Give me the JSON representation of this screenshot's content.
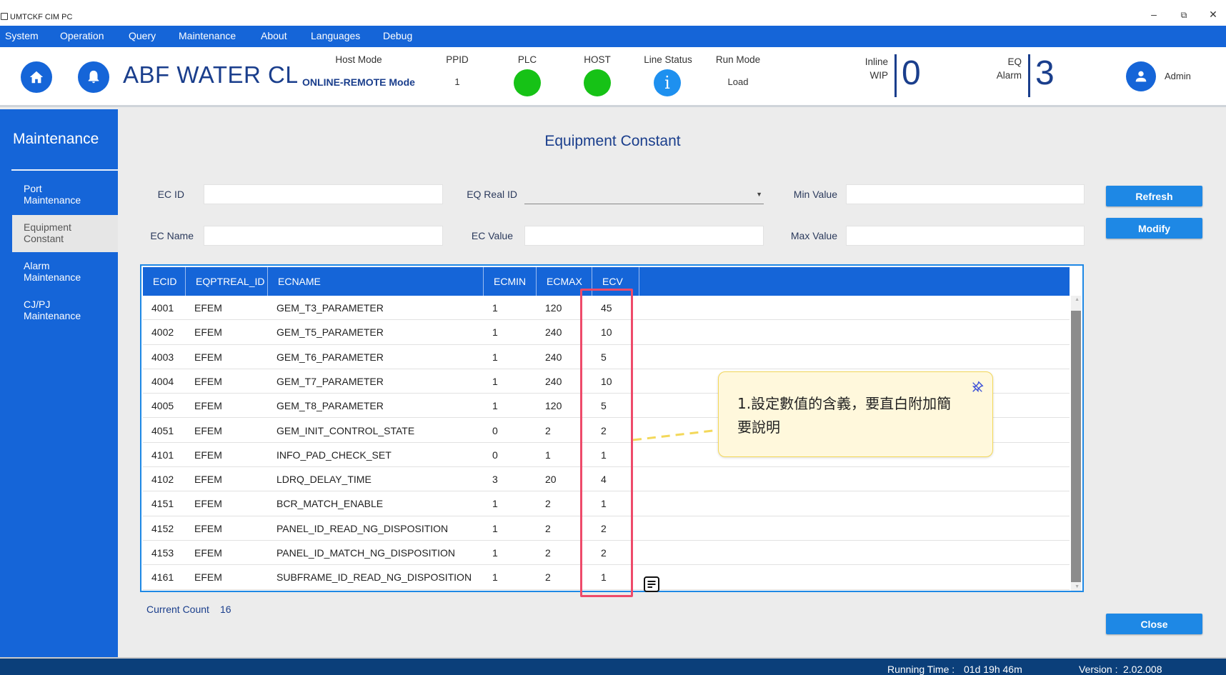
{
  "window": {
    "title": "UMTCKF CIM PC"
  },
  "menu": [
    "System",
    "Operation",
    "Query",
    "Maintenance",
    "About",
    "Languages",
    "Debug"
  ],
  "header": {
    "equipment_name": "ABF WATER CLEA",
    "host_mode": {
      "label": "Host Mode",
      "value": "ONLINE-REMOTE Mode"
    },
    "ppid": {
      "label": "PPID",
      "value": "1"
    },
    "plc": {
      "label": "PLC",
      "status_color": "#16c216"
    },
    "host": {
      "label": "HOST",
      "status_color": "#16c216"
    },
    "line_status": {
      "label": "Line Status",
      "icon": "info-icon"
    },
    "run_mode": {
      "label": "Run Mode",
      "value": "Load"
    },
    "inline_wip": {
      "label_1": "Inline",
      "label_2": "WIP",
      "value": "0"
    },
    "eq_alarm": {
      "label_1": "EQ",
      "label_2": "Alarm",
      "value": "3"
    },
    "user": "Admin"
  },
  "sidebar": {
    "title": "Maintenance",
    "items": [
      {
        "line1": "Port",
        "line2": "Maintenance",
        "active": false
      },
      {
        "line1": "Equipment",
        "line2": "Constant",
        "active": true
      },
      {
        "line1": "Alarm",
        "line2": "Maintenance",
        "active": false
      },
      {
        "line1": "CJ/PJ",
        "line2": "Maintenance",
        "active": false
      }
    ]
  },
  "main": {
    "title": "Equipment Constant",
    "form": {
      "ec_id_label": "EC ID",
      "ec_id_value": "",
      "eq_real_id_label": "EQ Real ID",
      "eq_real_id_value": "",
      "min_value_label": "Min Value",
      "min_value_value": "",
      "ec_name_label": "EC Name",
      "ec_name_value": "",
      "ec_value_label": "EC Value",
      "ec_value_value": "",
      "max_value_label": "Max Value",
      "max_value_value": ""
    },
    "buttons": {
      "refresh": "Refresh",
      "modify": "Modify",
      "close": "Close"
    },
    "table": {
      "columns": [
        "ECID",
        "EQPTREAL_ID",
        "ECNAME",
        "ECMIN",
        "ECMAX",
        "ECV"
      ],
      "rows": [
        [
          "4001",
          "EFEM",
          "GEM_T3_PARAMETER",
          "1",
          "120",
          "45"
        ],
        [
          "4002",
          "EFEM",
          "GEM_T5_PARAMETER",
          "1",
          "240",
          "10"
        ],
        [
          "4003",
          "EFEM",
          "GEM_T6_PARAMETER",
          "1",
          "240",
          "5"
        ],
        [
          "4004",
          "EFEM",
          "GEM_T7_PARAMETER",
          "1",
          "240",
          "10"
        ],
        [
          "4005",
          "EFEM",
          "GEM_T8_PARAMETER",
          "1",
          "120",
          "5"
        ],
        [
          "4051",
          "EFEM",
          "GEM_INIT_CONTROL_STATE",
          "0",
          "2",
          "2"
        ],
        [
          "4101",
          "EFEM",
          "INFO_PAD_CHECK_SET",
          "0",
          "1",
          "1"
        ],
        [
          "4102",
          "EFEM",
          "LDRQ_DELAY_TIME",
          "3",
          "20",
          "4"
        ],
        [
          "4151",
          "EFEM",
          "BCR_MATCH_ENABLE",
          "1",
          "2",
          "1"
        ],
        [
          "4152",
          "EFEM",
          "PANEL_ID_READ_NG_DISPOSITION",
          "1",
          "2",
          "2"
        ],
        [
          "4153",
          "EFEM",
          "PANEL_ID_MATCH_NG_DISPOSITION",
          "1",
          "2",
          "2"
        ],
        [
          "4161",
          "EFEM",
          "SUBFRAME_ID_READ_NG_DISPOSITION",
          "1",
          "2",
          "1"
        ]
      ]
    },
    "current_count_label": "Current Count",
    "current_count_value": "16"
  },
  "annotation": {
    "note_line1": "1.設定數值的含義，要直白附加簡",
    "note_line2": "要說明",
    "highlight_color": "#ee4a6a",
    "callout_color": "#fff8dc"
  },
  "footer": {
    "running_time_label": "Running Time :",
    "running_time_value": "01d 19h 46m",
    "version_label": "Version :",
    "version_value": "2.02.008"
  }
}
